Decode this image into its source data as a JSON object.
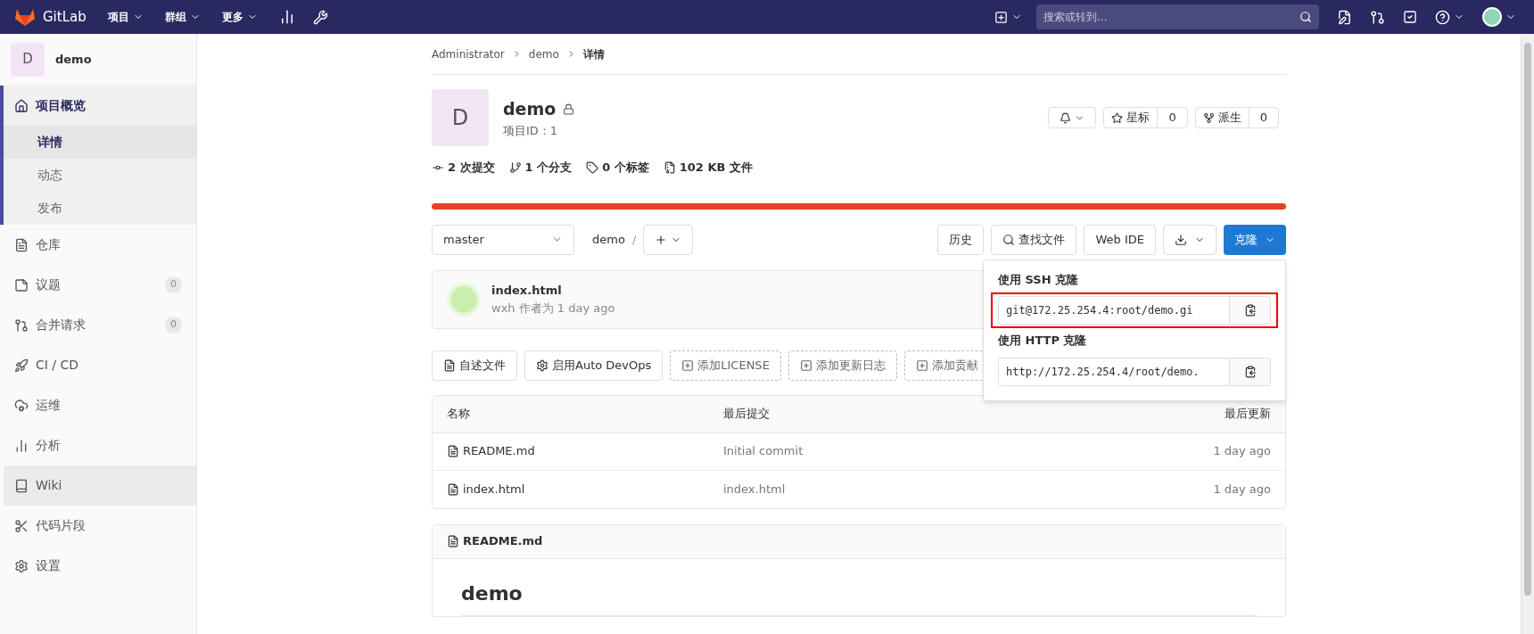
{
  "top_nav": {
    "brand": "GitLab",
    "menus": [
      {
        "label": "项目"
      },
      {
        "label": "群组"
      },
      {
        "label": "更多"
      }
    ],
    "search": {
      "placeholder": "搜索或转到..."
    }
  },
  "sidebar": {
    "project": {
      "avatar": "D",
      "name": "demo"
    },
    "items": [
      {
        "label": "项目概览",
        "selected": true,
        "hovered": false,
        "children": [
          {
            "label": "详情",
            "selected": true
          },
          {
            "label": "动态",
            "selected": false
          },
          {
            "label": "发布",
            "selected": false
          }
        ]
      },
      {
        "label": "仓库",
        "selected": false,
        "hovered": false
      },
      {
        "label": "议题",
        "count": "0",
        "selected": false,
        "hovered": false
      },
      {
        "label": "合并请求",
        "count": "0",
        "selected": false,
        "hovered": false
      },
      {
        "label": "CI / CD",
        "selected": false,
        "hovered": false
      },
      {
        "label": "运维",
        "selected": false,
        "hovered": false
      },
      {
        "label": "分析",
        "selected": false,
        "hovered": false
      },
      {
        "label": "Wiki",
        "selected": false,
        "hovered": true
      },
      {
        "label": "代码片段",
        "selected": false,
        "hovered": false
      },
      {
        "label": "设置",
        "selected": false,
        "hovered": false
      }
    ]
  },
  "breadcrumb": [
    "Administrator",
    "demo",
    "详情"
  ],
  "project": {
    "avatar": "D",
    "name": "demo",
    "id_label": "项目ID：1",
    "star": {
      "label": "星标",
      "count": "0"
    },
    "fork": {
      "label": "派生",
      "count": "0"
    }
  },
  "stats": [
    "2 次提交",
    "1 个分支",
    "0 个标签",
    "102 KB 文件"
  ],
  "languages": [
    {
      "color": "#e24329"
    }
  ],
  "toolbar": {
    "branch": "master",
    "path": "demo",
    "separator": "/",
    "history": "历史",
    "find": "查找文件",
    "web_ide": "Web IDE",
    "clone": "克隆"
  },
  "last_commit": {
    "title": "index.html",
    "meta": "wxh 作者为 1 day ago"
  },
  "quick_actions": [
    {
      "label": "自述文件",
      "kind": "solid"
    },
    {
      "label": "启用Auto DevOps",
      "kind": "solid"
    },
    {
      "label": "添加LICENSE",
      "kind": "dashed"
    },
    {
      "label": "添加更新日志",
      "kind": "dashed"
    },
    {
      "label": "添加贡献",
      "kind": "dashed"
    }
  ],
  "files": {
    "columns": [
      "名称",
      "最后提交",
      "最后更新"
    ],
    "rows": [
      {
        "name": "README.md",
        "commit": "Initial commit",
        "updated": "1 day ago"
      },
      {
        "name": "index.html",
        "commit": "index.html",
        "updated": "1 day ago"
      }
    ]
  },
  "readme": {
    "filename": "README.md",
    "heading": "demo"
  },
  "clone_dropdown": {
    "sections": [
      {
        "title": "使用 SSH 克隆",
        "value": "git@172.25.254.4:root/demo.gi",
        "highlighted": true
      },
      {
        "title": "使用 HTTP 克隆",
        "value": "http://172.25.254.4/root/demo.",
        "highlighted": false
      }
    ]
  }
}
